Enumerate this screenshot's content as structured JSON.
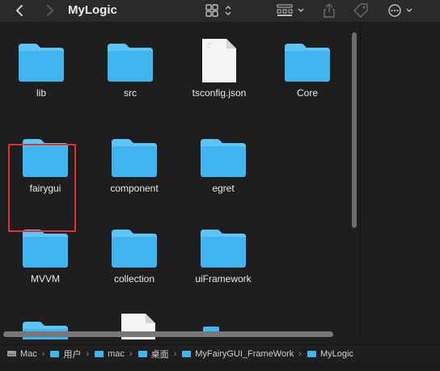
{
  "window": {
    "title": "MyLogic"
  },
  "toolbar": {
    "back": "chevron-left-icon",
    "forward": "chevron-right-icon",
    "view_mode": "grid-view-icon",
    "group": "group-by-icon",
    "share": "share-icon",
    "tag": "tag-icon",
    "more": "more-icon"
  },
  "items": [
    {
      "label": "lib",
      "kind": "folder"
    },
    {
      "label": "src",
      "kind": "folder"
    },
    {
      "label": "tsconfig.json",
      "kind": "file"
    },
    {
      "label": "Core",
      "kind": "folder"
    },
    {
      "label": "fairygui",
      "kind": "folder",
      "selected": true
    },
    {
      "label": "component",
      "kind": "folder"
    },
    {
      "label": "egret",
      "kind": "folder"
    },
    {
      "label": "MVVM",
      "kind": "folder"
    },
    {
      "label": "collection",
      "kind": "folder"
    },
    {
      "label": "uiFramework",
      "kind": "folder"
    }
  ],
  "pathbar": [
    {
      "label": "Mac",
      "icon": "disk-icon"
    },
    {
      "label": "用户",
      "icon": "folder-icon"
    },
    {
      "label": "mac",
      "icon": "folder-icon"
    },
    {
      "label": "桌面",
      "icon": "folder-icon"
    },
    {
      "label": "MyFairyGUI_FrameWork",
      "icon": "folder-icon"
    },
    {
      "label": "MyLogic",
      "icon": "folder-icon"
    }
  ],
  "colors": {
    "folder": "#3fb4ee",
    "folder_tab": "#5ec4f3",
    "selection": "#e03232"
  }
}
